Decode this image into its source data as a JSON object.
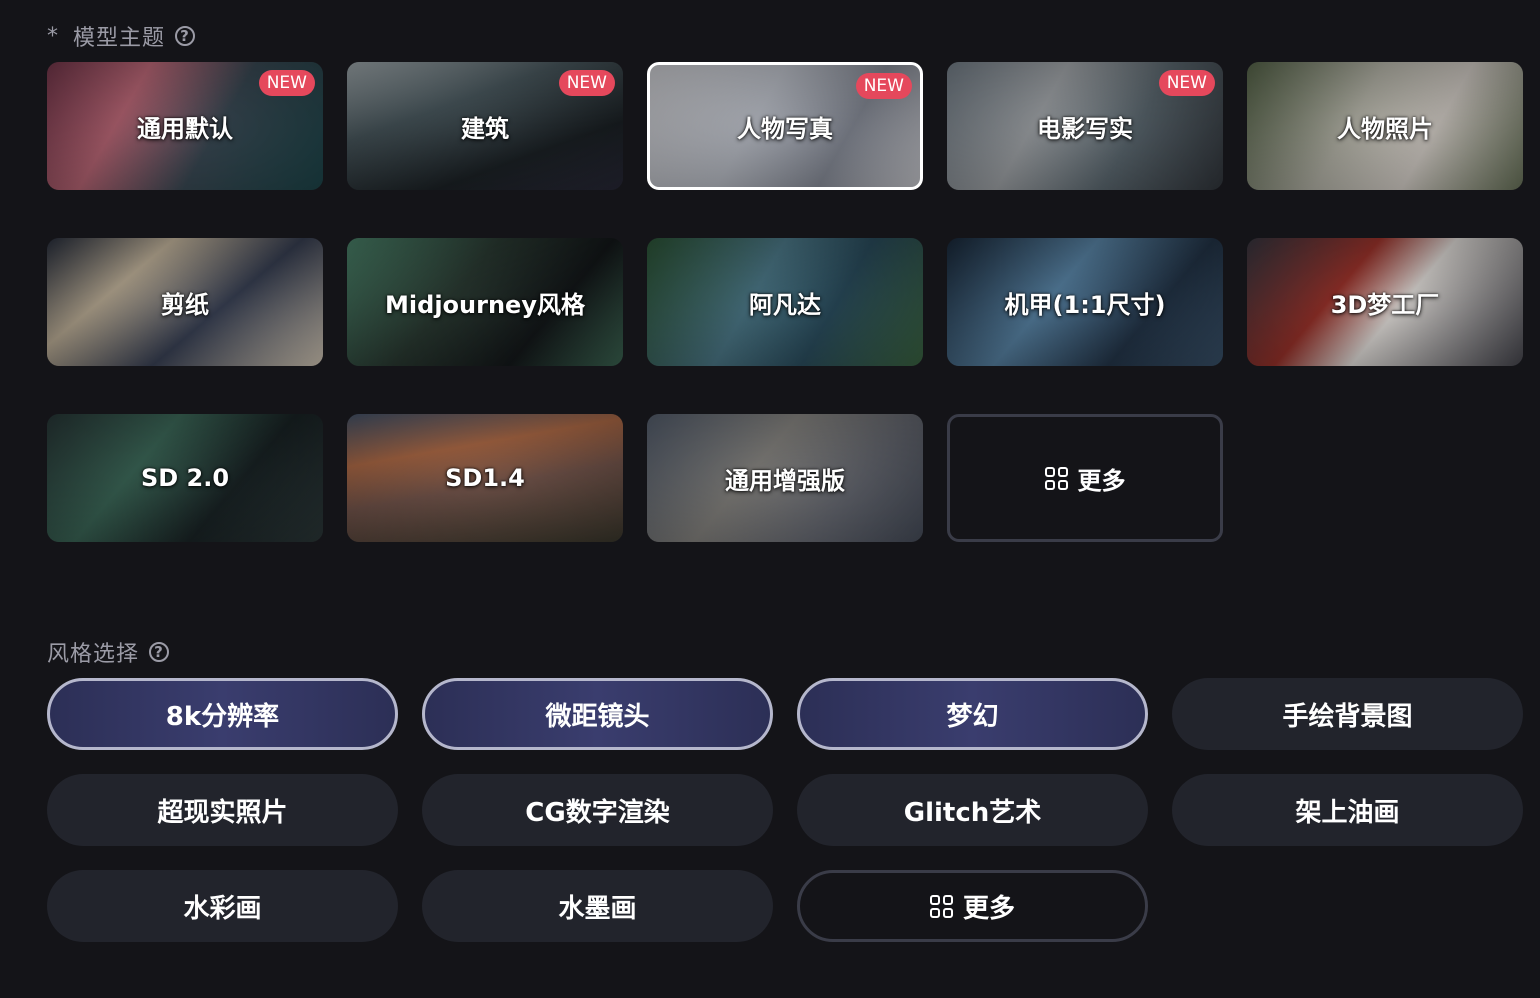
{
  "model_section": {
    "required_mark": "*",
    "title": "模型主题",
    "help_glyph": "?"
  },
  "models": [
    {
      "label": "通用默认",
      "badge": "NEW",
      "bg": "linear-gradient(120deg,#7a3a4f 0%,#c06a7a 30%,#3a4a55 60%,#1f4a4f 100%)"
    },
    {
      "label": "建筑",
      "badge": "NEW",
      "bg": "linear-gradient(160deg,#a8b2b6 0%,#4b5a60 35%,#1c2226 70%,#2a2a3a 100%)"
    },
    {
      "label": "人物写真",
      "badge": "NEW",
      "bg": "linear-gradient(120deg,#dadbe0 0%,#bfc3cc 40%,#8a8f9b 70%,#d5d6dc 100%)"
    },
    {
      "label": "电影写实",
      "badge": "NEW",
      "bg": "linear-gradient(120deg,#7b8690 0%,#a5a9ad 35%,#5d6a72 65%,#34393f 100%)"
    },
    {
      "label": "人物照片",
      "badge": "",
      "bg": "linear-gradient(120deg,#5b6a4d 0%,#b9b8ac 40%,#d8d2cb 65%,#6f7a5f 100%)"
    },
    {
      "label": "剪纸",
      "badge": "",
      "bg": "linear-gradient(140deg,#2a3140 0%,#c8b9a0 30%,#3a4256 60%,#e2d6c3 100%)"
    },
    {
      "label": "Midjourney风格",
      "badge": "",
      "bg": "linear-gradient(130deg,#4f8a70 0%,#2b3b33 40%,#14181a 70%,#3f6b57 100%)"
    },
    {
      "label": "阿凡达",
      "badge": "",
      "bg": "linear-gradient(120deg,#2f5a3a 0%,#4d7a8a 40%,#2b4e5f 65%,#3e6a45 100%)"
    },
    {
      "label": "机甲(1:1尺寸)",
      "badge": "",
      "bg": "linear-gradient(130deg,#1a2a3c 0%,#5a86a8 40%,#24364a 70%,#3c5670 100%)"
    },
    {
      "label": "3D梦工厂",
      "badge": "",
      "bg": "linear-gradient(130deg,#3a3a44 0%,#a0342c 35%,#e8e4e0 55%,#4a4a52 100%)"
    },
    {
      "label": "SD 2.0",
      "badge": "",
      "bg": "linear-gradient(130deg,#2a3a3a 0%,#3d6a5a 35%,#1a2426 65%,#2e3b3c 100%)"
    },
    {
      "label": "SD1.4",
      "badge": "",
      "bg": "linear-gradient(170deg,#4a5a72 0%,#b8704a 30%,#7a5a50 55%,#3d3a2e 100%)"
    },
    {
      "label": "通用增强版",
      "badge": "",
      "bg": "linear-gradient(130deg,#5a6474 0%,#8a8884 40%,#6a6d76 70%,#4b5260 100%)"
    }
  ],
  "models_more": {
    "label": "更多"
  },
  "style_section": {
    "title": "风格选择",
    "help_glyph": "?"
  },
  "styles": [
    {
      "label": "8k分辨率",
      "active": true
    },
    {
      "label": "微距镜头",
      "active": true
    },
    {
      "label": "梦幻",
      "active": true
    },
    {
      "label": "手绘背景图",
      "active": false
    },
    {
      "label": "超现实照片",
      "active": false
    },
    {
      "label": "CG数字渲染",
      "active": false
    },
    {
      "label": "Glitch艺术",
      "active": false
    },
    {
      "label": "架上油画",
      "active": false
    },
    {
      "label": "水彩画",
      "active": false
    },
    {
      "label": "水墨画",
      "active": false
    }
  ],
  "styles_more": {
    "label": "更多"
  },
  "colors": {
    "background": "#141418",
    "badge": "#e5485c",
    "pill": "#22242c",
    "pill_active": "#2c2f56"
  }
}
